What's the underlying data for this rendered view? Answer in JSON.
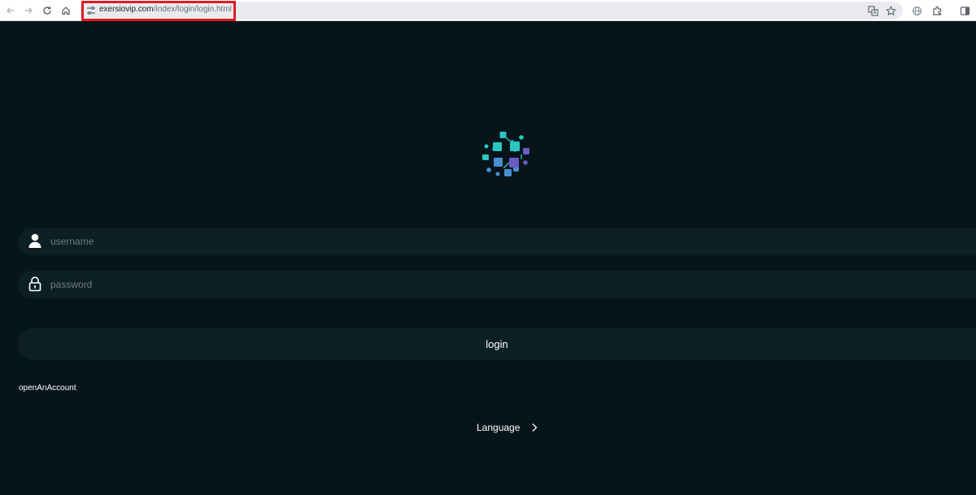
{
  "browser": {
    "url_domain": "exersiovip.com",
    "url_path": "/index/login/login.html"
  },
  "form": {
    "username_placeholder": "username",
    "password_placeholder": "password",
    "login_label": "login",
    "open_account_label": "openAnAccount",
    "language_label": "Language"
  },
  "icons": {
    "back": "arrow-left-icon",
    "forward": "arrow-right-icon",
    "reload": "reload-icon",
    "home": "home-icon",
    "site_info": "tune-icon",
    "translate": "translate-icon",
    "bookmark": "star-icon",
    "extension_globe": "globe-icon",
    "extensions": "puzzle-icon",
    "side_panel": "side-panel-icon",
    "user": "user-icon",
    "lock": "lock-icon",
    "chevron": "chevron-right-icon"
  },
  "colors": {
    "background": "#07151b",
    "field": "#0c1f25",
    "highlight": "#e11b22",
    "logo_teal": "#2bc6c0",
    "logo_blue": "#4a8fd1",
    "logo_purple": "#6a5bc4"
  }
}
